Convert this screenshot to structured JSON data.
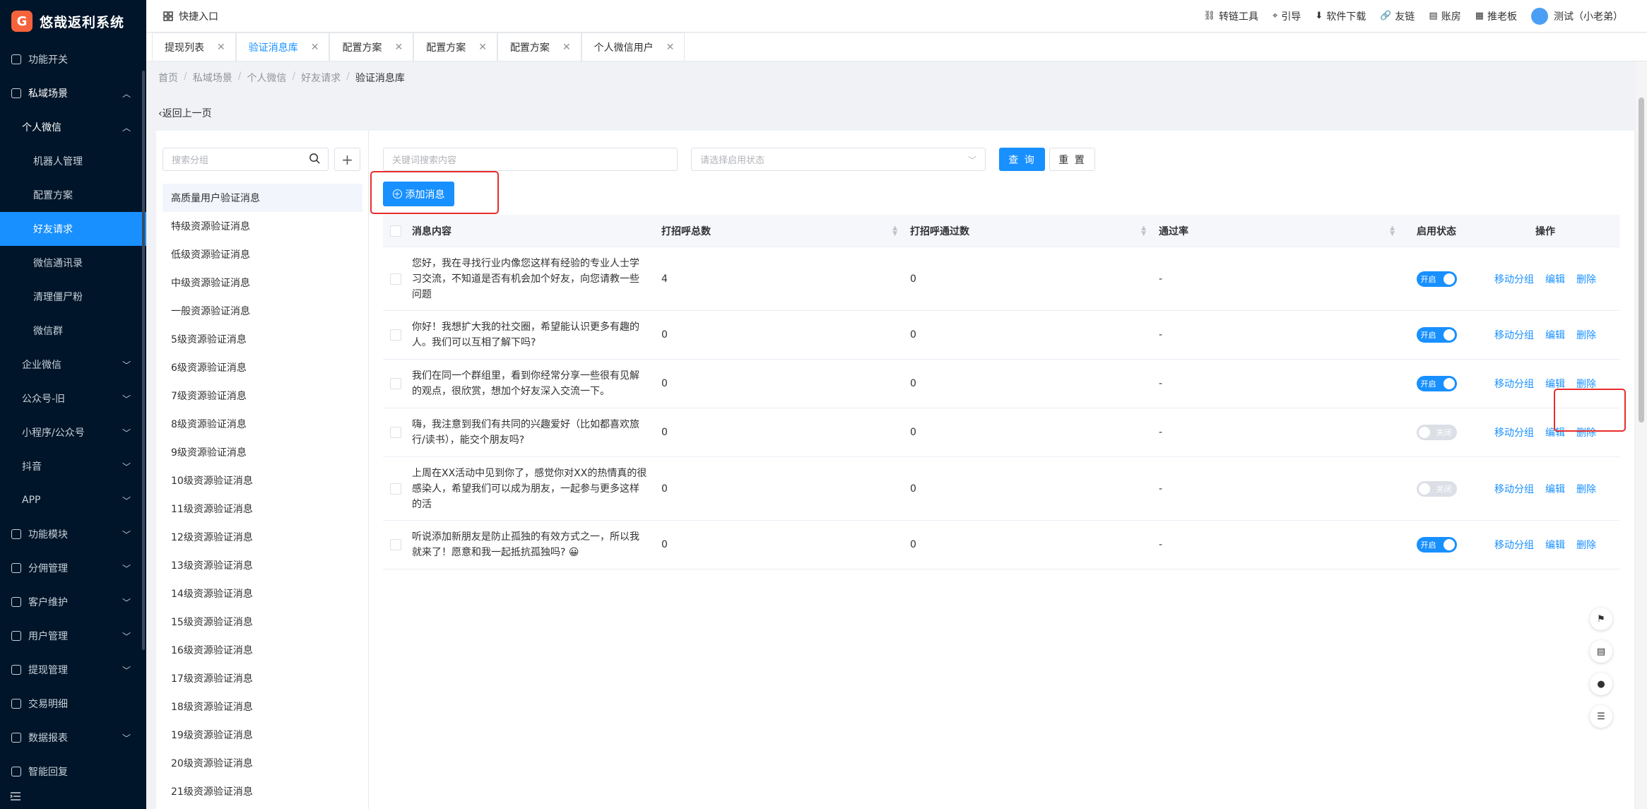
{
  "app": {
    "title": "悠哉返利系统",
    "logo_glyph": "G"
  },
  "sidebar": {
    "items": [
      {
        "label": "功能开关",
        "level": 0,
        "icon": "grid-icon",
        "state": ""
      },
      {
        "label": "私域场景",
        "level": 0,
        "icon": "target-icon",
        "state": "open"
      },
      {
        "label": "个人微信",
        "level": 1,
        "icon": "",
        "state": "open"
      },
      {
        "label": "机器人管理",
        "level": 2,
        "icon": "",
        "state": ""
      },
      {
        "label": "配置方案",
        "level": 2,
        "icon": "",
        "state": ""
      },
      {
        "label": "好友请求",
        "level": 2,
        "icon": "",
        "state": "active"
      },
      {
        "label": "微信通讯录",
        "level": 2,
        "icon": "",
        "state": ""
      },
      {
        "label": "清理僵尸粉",
        "level": 2,
        "icon": "",
        "state": ""
      },
      {
        "label": "微信群",
        "level": 2,
        "icon": "",
        "state": ""
      },
      {
        "label": "企业微信",
        "level": 1,
        "icon": "",
        "state": "collapsed"
      },
      {
        "label": "公众号-旧",
        "level": 1,
        "icon": "",
        "state": "collapsed"
      },
      {
        "label": "小程序/公众号",
        "level": 1,
        "icon": "",
        "state": "collapsed"
      },
      {
        "label": "抖音",
        "level": 1,
        "icon": "",
        "state": "collapsed"
      },
      {
        "label": "APP",
        "level": 1,
        "icon": "",
        "state": "collapsed"
      },
      {
        "label": "功能模块",
        "level": 0,
        "icon": "module-icon",
        "state": "collapsed"
      },
      {
        "label": "分佣管理",
        "level": 0,
        "icon": "commission-icon",
        "state": "collapsed"
      },
      {
        "label": "客户维护",
        "level": 0,
        "icon": "customer-icon",
        "state": "collapsed"
      },
      {
        "label": "用户管理",
        "level": 0,
        "icon": "user-icon",
        "state": "collapsed"
      },
      {
        "label": "提现管理",
        "level": 0,
        "icon": "withdraw-icon",
        "state": "collapsed"
      },
      {
        "label": "交易明细",
        "level": 0,
        "icon": "trade-icon",
        "state": ""
      },
      {
        "label": "数据报表",
        "level": 0,
        "icon": "chart-icon",
        "state": "collapsed"
      },
      {
        "label": "智能回复",
        "level": 0,
        "icon": "reply-icon",
        "state": ""
      }
    ]
  },
  "topbar": {
    "quick_entry": "快捷入口",
    "links": [
      {
        "label": "转链工具",
        "icon": "link-tool-icon"
      },
      {
        "label": "引导",
        "icon": "pin-icon"
      },
      {
        "label": "软件下载",
        "icon": "download-icon"
      },
      {
        "label": "友链",
        "icon": "chain-icon"
      },
      {
        "label": "账房",
        "icon": "ledger-icon"
      },
      {
        "label": "推老板",
        "icon": "board-icon"
      }
    ],
    "user": "测试（小老弟）"
  },
  "tabs": [
    {
      "label": "提现列表",
      "active": false
    },
    {
      "label": "验证消息库",
      "active": true
    },
    {
      "label": "配置方案",
      "active": false
    },
    {
      "label": "配置方案",
      "active": false
    },
    {
      "label": "配置方案",
      "active": false
    },
    {
      "label": "个人微信用户",
      "active": false
    }
  ],
  "breadcrumb": [
    "首页",
    "私域场景",
    "个人微信",
    "好友请求",
    "验证消息库"
  ],
  "back_label": "返回上一页",
  "groups": {
    "search_placeholder": "搜索分组",
    "add_label": "+",
    "items": [
      "高质量用户验证消息",
      "特级资源验证消息",
      "低级资源验证消息",
      "中级资源验证消息",
      "一般资源验证消息",
      "5级资源验证消息",
      "6级资源验证消息",
      "7级资源验证消息",
      "8级资源验证消息",
      "9级资源验证消息",
      "10级资源验证消息",
      "11级资源验证消息",
      "12级资源验证消息",
      "13级资源验证消息",
      "14级资源验证消息",
      "15级资源验证消息",
      "16级资源验证消息",
      "17级资源验证消息",
      "18级资源验证消息",
      "19级资源验证消息",
      "20级资源验证消息",
      "21级资源验证消息"
    ],
    "selected": 0
  },
  "filters": {
    "keyword_placeholder": "关键词搜索内容",
    "status_placeholder": "请选择启用状态",
    "query_label": "查 询",
    "reset_label": "重 置"
  },
  "add_button_label": "添加消息",
  "table": {
    "headers": {
      "content": "消息内容",
      "total": "打招呼总数",
      "passed": "打招呼通过数",
      "rate": "通过率",
      "status": "启用状态",
      "ops": "操作"
    },
    "rows": [
      {
        "content": "您好，我在寻找行业内像您这样有经验的专业人士学习交流，不知道是否有机会加个好友，向您请教一些问题",
        "total": "4",
        "passed": "0",
        "rate": "-",
        "enabled": true,
        "status_text": "开启"
      },
      {
        "content": "你好！我想扩大我的社交圈，希望能认识更多有趣的人。我们可以互相了解下吗?",
        "total": "0",
        "passed": "0",
        "rate": "-",
        "enabled": true,
        "status_text": "开启"
      },
      {
        "content": "我们在同一个群组里，看到你经常分享一些很有见解的观点，很欣赏，想加个好友深入交流一下。",
        "total": "0",
        "passed": "0",
        "rate": "-",
        "enabled": true,
        "status_text": "开启"
      },
      {
        "content": "嗨，我注意到我们有共同的兴趣爱好（比如都喜欢旅行/读书），能交个朋友吗?",
        "total": "0",
        "passed": "0",
        "rate": "-",
        "enabled": false,
        "status_text": "关闭"
      },
      {
        "content": "上周在XX活动中见到你了，感觉你对XX的热情真的很感染人，希望我们可以成为朋友，一起参与更多这样的活",
        "total": "0",
        "passed": "0",
        "rate": "-",
        "enabled": false,
        "status_text": "关闭"
      },
      {
        "content": "听说添加新朋友是防止孤独的有效方式之一，所以我就来了！愿意和我一起抵抗孤独吗? 😀",
        "total": "0",
        "passed": "0",
        "rate": "-",
        "enabled": true,
        "status_text": "开启"
      }
    ],
    "actions": {
      "move": "移动分组",
      "edit": "编辑",
      "delete": "删除"
    }
  },
  "colors": {
    "primary": "#1890ff",
    "sidebar_bg": "#001529",
    "highlight": "#e82c2c"
  }
}
